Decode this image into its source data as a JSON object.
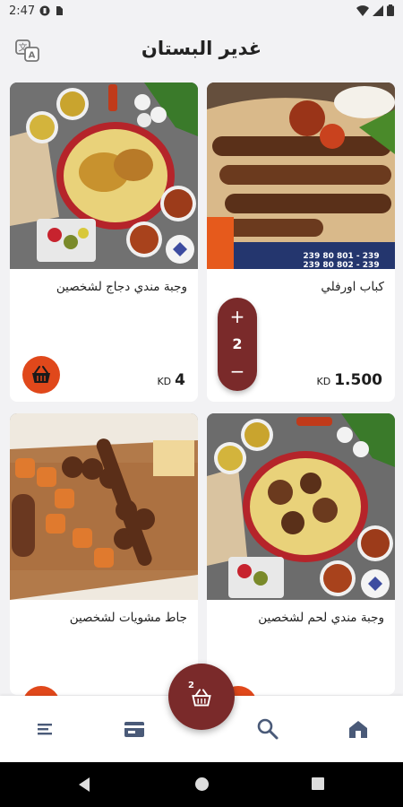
{
  "status_bar": {
    "time": "2:47"
  },
  "header": {
    "title": "غدير البستان"
  },
  "colors": {
    "accent": "#7a2a2a",
    "cart_orange": "#e0481b",
    "background": "#f2f2f4"
  },
  "products": [
    {
      "name": "وجبة مندي دجاج لشخصين",
      "price": "4",
      "currency": "KD",
      "in_cart": false
    },
    {
      "name": "كباب اورفلي",
      "price": "1.500",
      "currency": "KD",
      "in_cart": true,
      "quantity": "2"
    },
    {
      "name": "جاط مشويات لشخصين",
      "in_cart": false
    },
    {
      "name": "وجبة مندي لحم لشخصين",
      "in_cart": false
    }
  ],
  "image_texts": {
    "kabab_banner_line1": "239 80 801 - 239",
    "kabab_banner_line2": "239 80 802 - 239"
  },
  "cart": {
    "count": "2"
  },
  "nav": {
    "icons": [
      "menu-icon",
      "card-icon",
      "search-icon",
      "home-icon"
    ]
  }
}
